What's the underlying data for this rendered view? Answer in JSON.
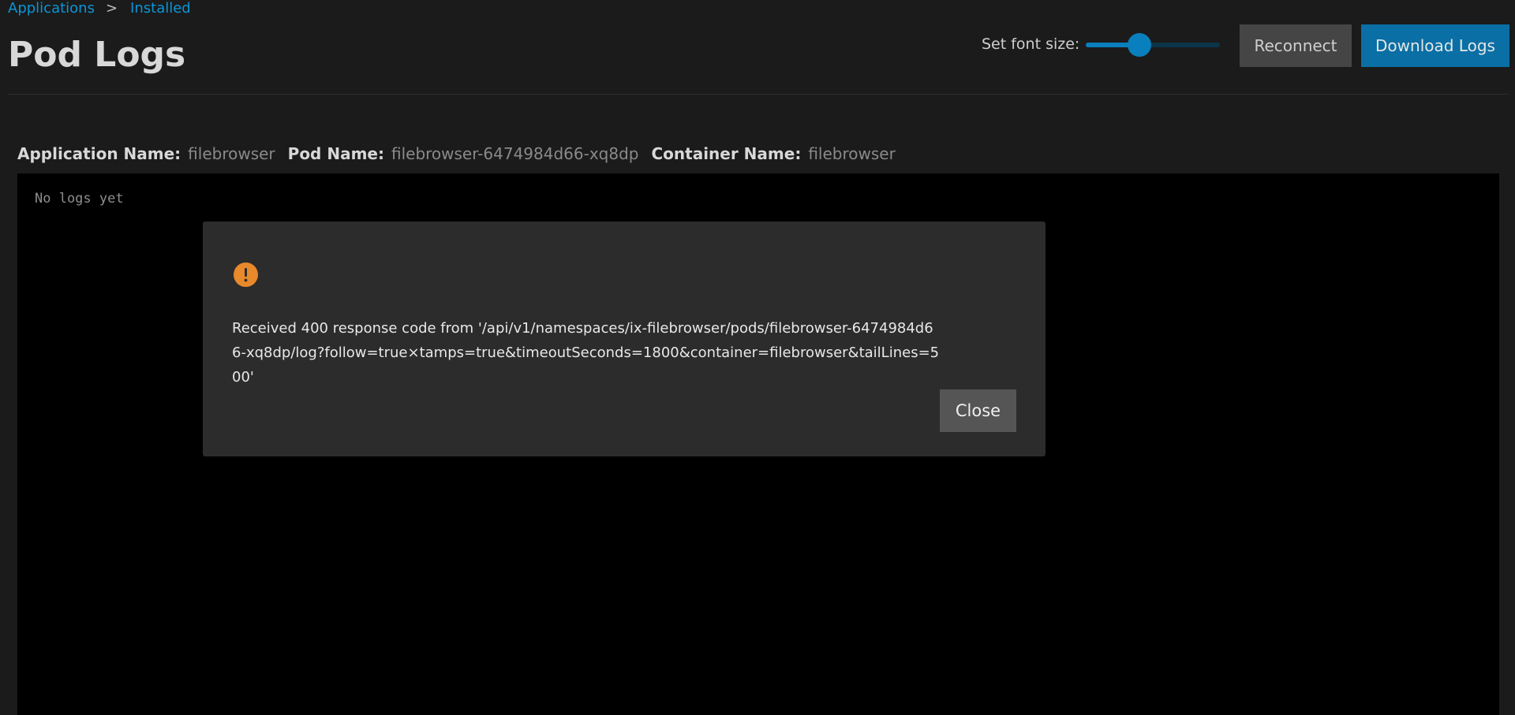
{
  "breadcrumb": {
    "items": [
      "Applications",
      "Installed"
    ],
    "separator": ">"
  },
  "page": {
    "title": "Pod Logs"
  },
  "controls": {
    "font_size_label": "Set font size:",
    "font_size_slider_value": 0.4,
    "reconnect_label": "Reconnect",
    "download_label": "Download Logs"
  },
  "info": {
    "application_label": "Application Name:",
    "application_value": "filebrowser",
    "pod_label": "Pod Name:",
    "pod_value": "filebrowser-6474984d66-xq8dp",
    "container_label": "Container Name:",
    "container_value": "filebrowser"
  },
  "logs": {
    "text": "No logs yet"
  },
  "dialog": {
    "icon": "warning-icon",
    "message": "Received 400 response code from '/api/v1/namespaces/ix-filebrowser/pods/filebrowser-6474984d66-xq8dp/log?follow=true×tamps=true&timeoutSeconds=1800&container=filebrowser&tailLines=500'",
    "close_label": "Close"
  },
  "colors": {
    "accent": "#0a6fa5",
    "link": "#0a95d6",
    "warning": "#e8892b",
    "background": "#1b1b1b",
    "log_background": "#000000",
    "dialog_background": "#2c2c2c"
  }
}
